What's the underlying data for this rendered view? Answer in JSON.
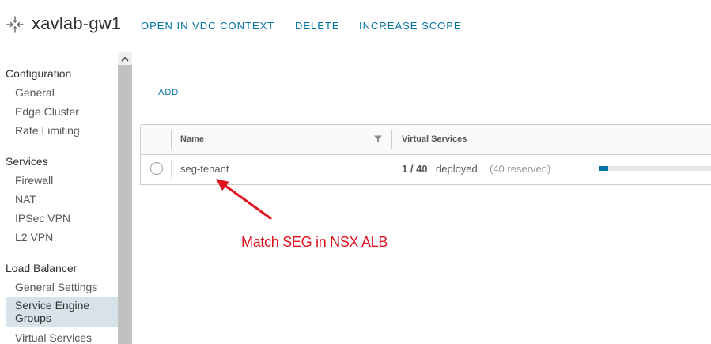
{
  "header": {
    "title": "xavlab-gw1",
    "actions": [
      "OPEN IN VDC CONTEXT",
      "DELETE",
      "INCREASE SCOPE"
    ]
  },
  "sidebar": {
    "sections": [
      {
        "title": "Configuration",
        "items": [
          "General",
          "Edge Cluster",
          "Rate Limiting"
        ]
      },
      {
        "title": "Services",
        "items": [
          "Firewall",
          "NAT",
          "IPSec VPN",
          "L2 VPN"
        ]
      },
      {
        "title": "Load Balancer",
        "items": [
          "General Settings",
          "Service Engine Groups",
          "Virtual Services"
        ]
      }
    ],
    "selected_item": "Service Engine Groups"
  },
  "content": {
    "add_label": "ADD",
    "columns": [
      "Name",
      "Virtual Services"
    ],
    "rows": [
      {
        "name": "seg-tenant",
        "vs_count": "1 / 40",
        "vs_status": "deployed",
        "vs_reserved": "(40 reserved)",
        "usage_fraction": 0.075
      }
    ]
  },
  "annotation": {
    "text": "Match SEG in NSX ALB",
    "color": "#e0141e"
  },
  "colors": {
    "accent": "#0072a3",
    "selected_bg": "#d8e3e9"
  }
}
